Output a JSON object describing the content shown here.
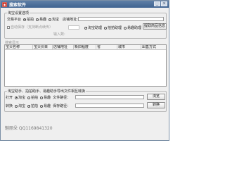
{
  "window": {
    "title": "搜索软件",
    "minimize_glyph": "_",
    "close_glyph": "x",
    "app_icon": "app-icon"
  },
  "settings": {
    "group_title": "淘宝设置选项",
    "platform_label": "交易平台",
    "platforms": [
      {
        "label": "拍拍",
        "selected": true
      },
      {
        "label": "易趣",
        "selected": false
      },
      {
        "label": "淘宝",
        "selected": false
      }
    ],
    "shop_url_label": "店铺地址:",
    "shop_url_value": "",
    "auto_collect_label": "自动保存（支持断点续传）",
    "input_count_label": "输入数:",
    "input_count_value": "",
    "mode_options": [
      {
        "label": "淘宝助理",
        "selected": true
      },
      {
        "label": "拍拍助理",
        "selected": false
      },
      {
        "label": "易趣助理",
        "selected": false
      }
    ],
    "extract_button": "提取商品信息"
  },
  "results": {
    "group_title": "搜索显示",
    "columns": [
      "宝贝名称",
      "宝贝价目",
      "店铺地址",
      "新旧程度",
      "省",
      "城市",
      "出售方式"
    ]
  },
  "convert": {
    "group_title": "淘宝助手、拍拍助手、易趣助手导出文件相互转换",
    "open_label": "打开",
    "open_options": [
      {
        "label": "淘宝",
        "selected": true
      },
      {
        "label": "拍拍",
        "selected": false
      },
      {
        "label": "易趣",
        "selected": false
      }
    ],
    "file_path_label": "文件路径：",
    "file_path_value": "",
    "browse_button": "浏览",
    "convert_label": "转换",
    "convert_options": [
      {
        "label": "淘宝",
        "selected": false
      },
      {
        "label": "拍拍",
        "selected": true
      },
      {
        "label": "易趣",
        "selected": false
      }
    ],
    "save_path_label": "保存路径：",
    "save_path_value": "",
    "convert_button": "转换"
  },
  "footer": {
    "contact_text": "魅丽朵 QQ1169841320"
  }
}
